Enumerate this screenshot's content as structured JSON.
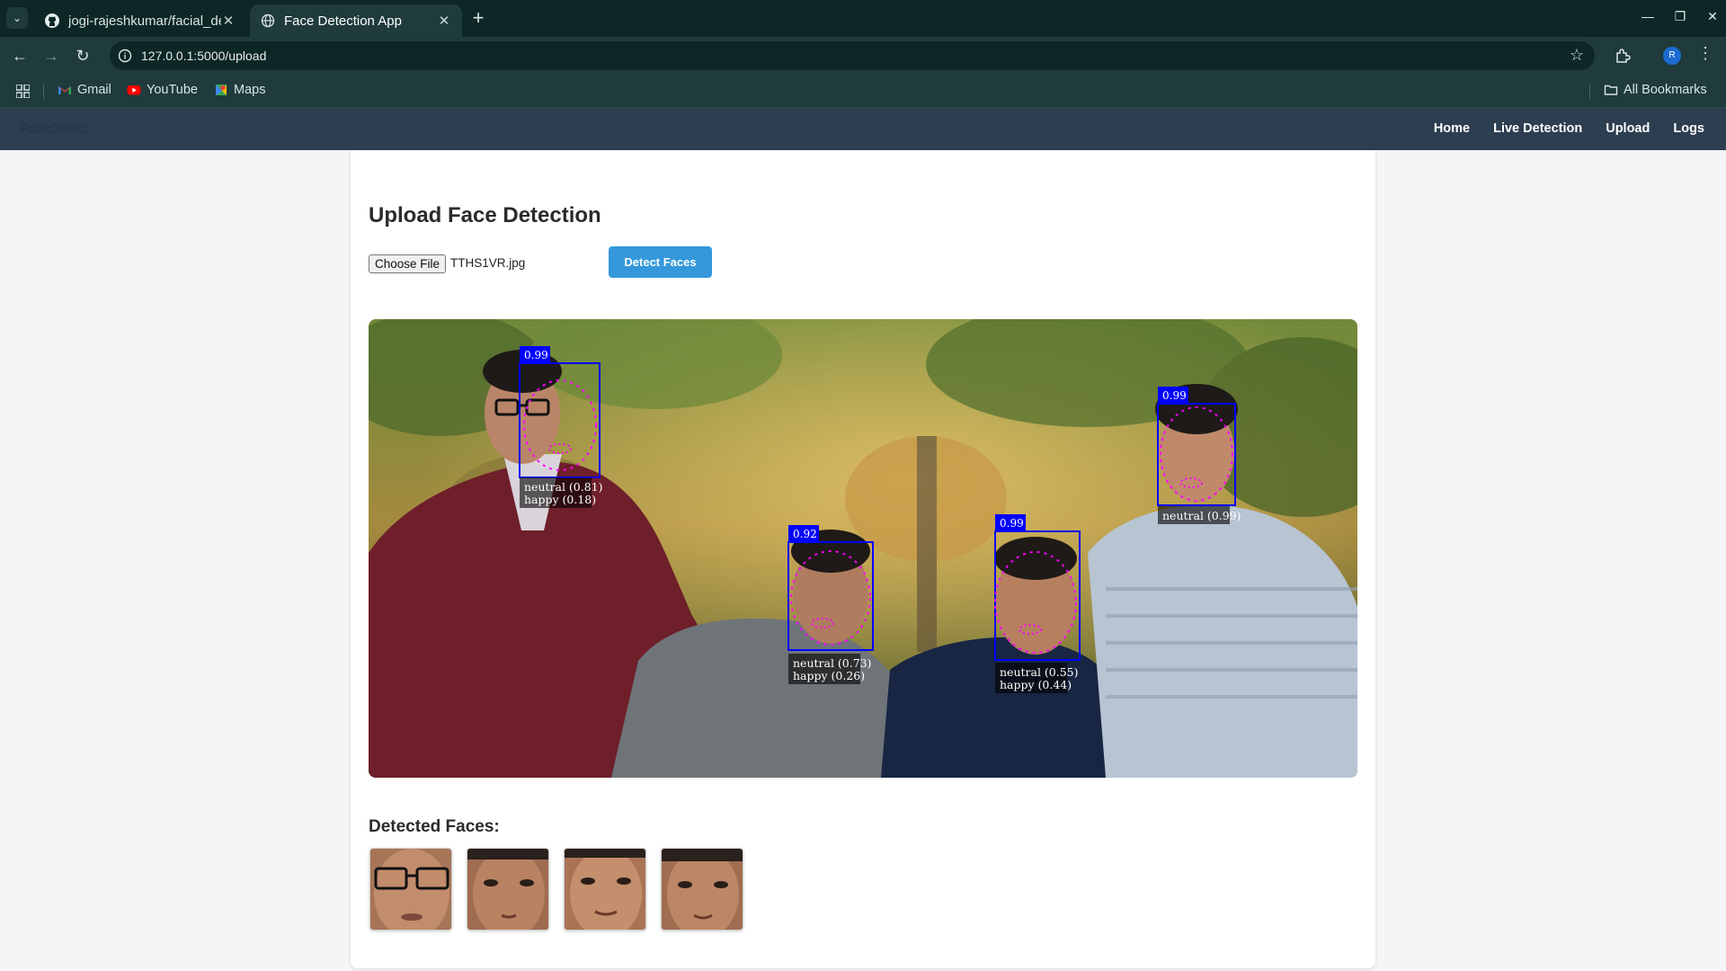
{
  "browser": {
    "tabs": [
      {
        "title": "jogi-rajeshkumar/facial_detection",
        "active": false,
        "icon": "github-icon"
      },
      {
        "title": "Face Detection App",
        "active": true,
        "icon": "globe-icon"
      }
    ],
    "url": "127.0.0.1:5000/upload",
    "profile_initial": "R",
    "bookmarks": [
      {
        "label": "Gmail",
        "icon": "gmail-icon"
      },
      {
        "label": "YouTube",
        "icon": "youtube-icon"
      },
      {
        "label": "Maps",
        "icon": "maps-icon"
      }
    ],
    "all_bookmarks": "All Bookmarks"
  },
  "app": {
    "brand": "FaceDetect",
    "nav": [
      "Home",
      "Live Detection",
      "Upload",
      "Logs"
    ],
    "page_title": "Upload Face Detection",
    "choose_file_label": "Choose File",
    "file_name": "TTHS1VR.jpg",
    "detect_button": "Detect Faces",
    "detected_title": "Detected Faces:",
    "thumbnail_count": 4
  },
  "detections": [
    {
      "score": "0.99",
      "emotions": [
        "neutral (0.81)",
        "happy (0.18)"
      ]
    },
    {
      "score": "0.92",
      "emotions": [
        "neutral (0.73)",
        "happy (0.26)"
      ]
    },
    {
      "score": "0.99",
      "emotions": [
        "neutral (0.55)",
        "happy (0.44)"
      ]
    },
    {
      "score": "0.99",
      "emotions": [
        "neutral (0.99)"
      ]
    }
  ],
  "colors": {
    "nav_bg": "#2c3e50",
    "button_bg": "#3498db",
    "box_color": "#0000ff",
    "landmark_color": "#ff00ff",
    "chrome_bg": "#0d2626"
  }
}
